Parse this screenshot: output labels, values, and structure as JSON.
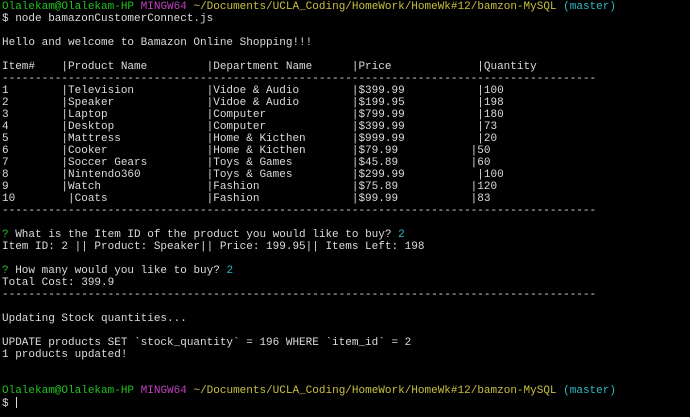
{
  "prompt": {
    "user_host": "Olalekam@Olalekam-HP",
    "shell": "MINGW64",
    "path": "~/Documents/UCLA_Coding/HomeWork/HomeWk#12/bamzon-MySQL",
    "branch": "(master)",
    "symbol": "$ "
  },
  "command": "node bamazonCustomerConnect.js",
  "welcome": "Hello and welcome to Bamazon Online Shopping!!!",
  "table": {
    "header": "Item#    |Product Name         |Department Name      |Price             |Quantity",
    "divider": "------------------------------------------------------------------------------------------",
    "rows": [
      "1        |Television           |Vidoe & Audio        |$399.99           |100",
      "2        |Speaker              |Vidoe & Audio        |$199.95           |198",
      "3        |Laptop               |Computer             |$799.99           |180",
      "4        |Desktop              |Computer             |$399.99           |73",
      "5        |Mattress             |Home & Kicthen       |$999.99           |20",
      "6        |Cooker               |Home & Kicthen       |$79.99           |50",
      "7        |Soccer Gears         |Toys & Games         |$45.89           |60",
      "8        |Nintendo360          |Toys & Games         |$299.99           |100",
      "9        |Watch                |Fashion              |$75.89           |120",
      "10        |Coats               |Fashion              |$99.99           |83"
    ]
  },
  "q1": {
    "mark": "?",
    "text": " What is the Item ID of the product you would like to buy? ",
    "answer": "2"
  },
  "item_info": "Item ID: 2 || Product: Speaker|| Price: 199.95|| Items Left: 198",
  "q2": {
    "mark": "?",
    "text": " How many would you like to buy? ",
    "answer": "2"
  },
  "total": "Total Cost: 399.9",
  "divider2": "------------------------------------------------------------------------------------------",
  "updating": "Updating Stock quantities...",
  "sql": "UPDATE products SET `stock_quantity` = 196 WHERE `item_id` = 2",
  "updated": "1 products updated!",
  "prompt2_symbol": "$ "
}
